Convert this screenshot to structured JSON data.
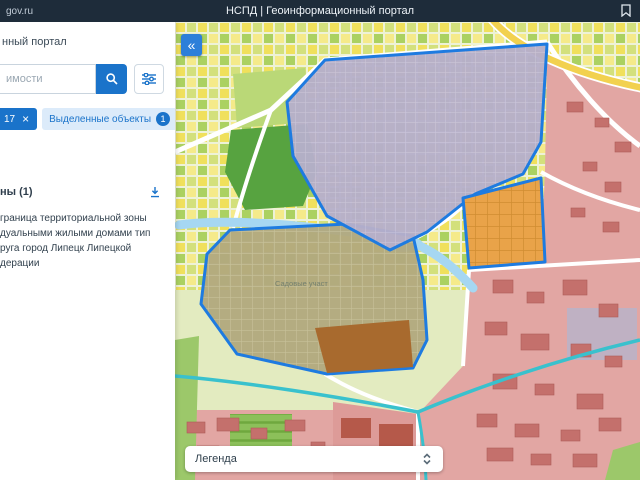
{
  "topbar": {
    "brand": "gov.ru",
    "title": "НСПД | Геоинформационный портал"
  },
  "sidebar": {
    "portal_title": "нный портал",
    "search": {
      "placeholder": "имости",
      "search_icon": "magnifier",
      "filter_icon": "sliders"
    },
    "tabs": [
      {
        "label": "17",
        "close": "×"
      },
      {
        "label": "Выделенные объекты",
        "badge": "1",
        "close": "×"
      }
    ],
    "results": {
      "group_title": "ны (1)",
      "download_icon": "download-arrow",
      "item_lines": [
        "граница территориальной зоны",
        "дуальными жилыми домами тип",
        "руга город Липецк Липецкой",
        "дерации"
      ]
    }
  },
  "map": {
    "collapse_button": "«",
    "area_label": "Садовые участ",
    "legend": {
      "label": "Легенда"
    },
    "colors": {
      "selection_outline": "#1e7be0",
      "zone_residential_purple": "#b6afca",
      "zone_garden_olive": "#b2a97e",
      "zone_orange": "#e9a349",
      "zone_pink": "#e2a6a3",
      "parcel_yellow": "#f0e05c",
      "parcel_green": "#abd161",
      "forest_green": "#57a340",
      "water_blue": "#a6d7f2",
      "road_yellow": "#f2d14f",
      "road_teal": "#39c1cd"
    }
  }
}
